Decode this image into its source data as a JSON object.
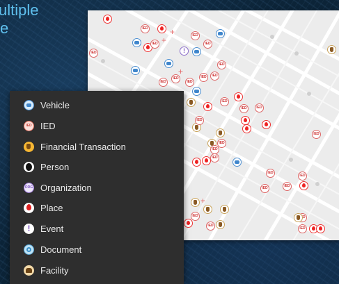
{
  "headline": {
    "line1": "ultiple",
    "line2": "e"
  },
  "legend": {
    "items": [
      {
        "label": "Vehicle",
        "icon": "vehicle-icon"
      },
      {
        "label": "IED",
        "icon": "ied-icon"
      },
      {
        "label": "Financial Transaction",
        "icon": "financial-transaction-icon"
      },
      {
        "label": "Person",
        "icon": "person-icon"
      },
      {
        "label": "Organization",
        "icon": "organization-icon"
      },
      {
        "label": "Place",
        "icon": "place-icon"
      },
      {
        "label": "Event",
        "icon": "event-icon"
      },
      {
        "label": "Document",
        "icon": "document-icon"
      },
      {
        "label": "Facility",
        "icon": "facility-icon"
      }
    ]
  },
  "map": {
    "marker_text": "IED",
    "event_glyph": "!"
  },
  "colors": {
    "headline": "#5fc0ee",
    "legend_bg": "#2e2e2e",
    "map_bg": "#ececec",
    "place": "#e02020",
    "vehicle": "#3f86cc"
  }
}
